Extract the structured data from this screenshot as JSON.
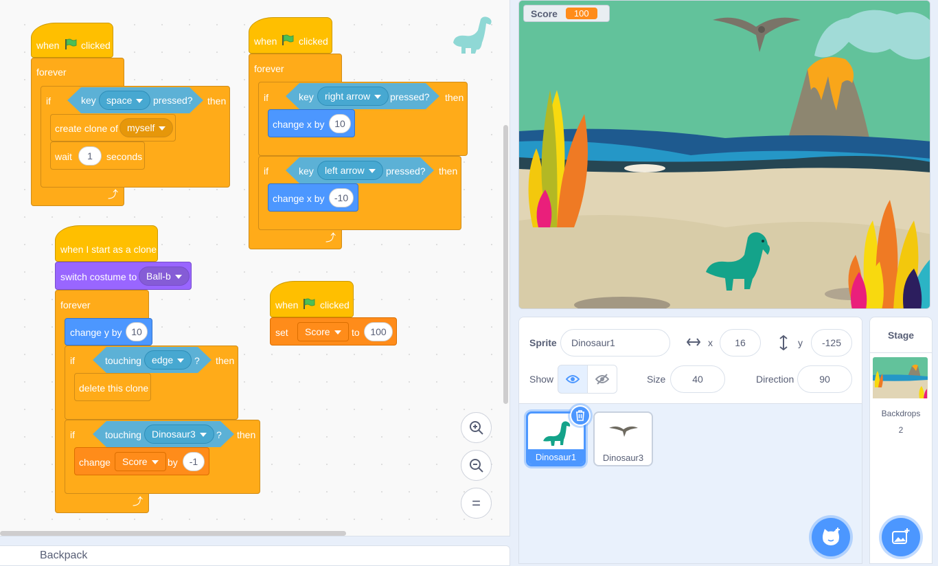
{
  "workspace": {
    "backpack_label": "Backpack",
    "scripts": {
      "s1": {
        "when": "when",
        "clicked": "clicked",
        "forever": "forever",
        "if": "if",
        "key": "key",
        "key_value": "space",
        "pressed": "pressed?",
        "then": "then",
        "create_clone": "create clone of",
        "clone_target": "myself",
        "wait": "wait",
        "wait_value": "1",
        "seconds": "seconds"
      },
      "s2": {
        "when": "when",
        "clicked": "clicked",
        "forever": "forever",
        "if1": "if",
        "key1": "key",
        "key1_value": "right arrow",
        "pressed1": "pressed?",
        "then1": "then",
        "change_x1": "change x by",
        "change_x1_value": "10",
        "if2": "if",
        "key2": "key",
        "key2_value": "left arrow",
        "pressed2": "pressed?",
        "then2": "then",
        "change_x2": "change x by",
        "change_x2_value": "-10"
      },
      "s3": {
        "hat": "when I start as a clone",
        "switch_costume": "switch costume to",
        "costume": "Ball-b",
        "forever": "forever",
        "change_y": "change y by",
        "change_y_value": "10",
        "if1": "if",
        "touching1": "touching",
        "touching1_value": "edge",
        "q1": "?",
        "then1": "then",
        "delete_clone": "delete this clone",
        "if2": "if",
        "touching2": "touching",
        "touching2_value": "Dinosaur3",
        "q2": "?",
        "then2": "then",
        "change": "change",
        "change_var": "Score",
        "by": "by",
        "by_value": "-1"
      },
      "s4": {
        "when": "when",
        "clicked": "clicked",
        "set": "set",
        "set_var": "Score",
        "to": "to",
        "to_value": "100"
      }
    },
    "zoom": {
      "in": "+",
      "out": "−",
      "reset": "="
    }
  },
  "stage": {
    "monitor": {
      "label": "Score",
      "value": "100"
    }
  },
  "sprite_info": {
    "sprite_label": "Sprite",
    "sprite_name": "Dinosaur1",
    "x_label": "x",
    "x_value": "16",
    "y_label": "y",
    "y_value": "-125",
    "show_label": "Show",
    "size_label": "Size",
    "size_value": "40",
    "direction_label": "Direction",
    "direction_value": "90"
  },
  "sprites": [
    {
      "name": "Dinosaur1",
      "selected": true
    },
    {
      "name": "Dinosaur3",
      "selected": false
    }
  ],
  "stage_panel": {
    "title": "Stage",
    "backdrops_label": "Backdrops",
    "backdrops_count": "2"
  },
  "colors": {
    "events": "#ffbf00",
    "control": "#ffab19",
    "motion": "#4c97ff",
    "sensing": "#5cb1d6",
    "looks": "#9966ff",
    "variables": "#ff8c1a",
    "accent": "#4c97ff"
  }
}
